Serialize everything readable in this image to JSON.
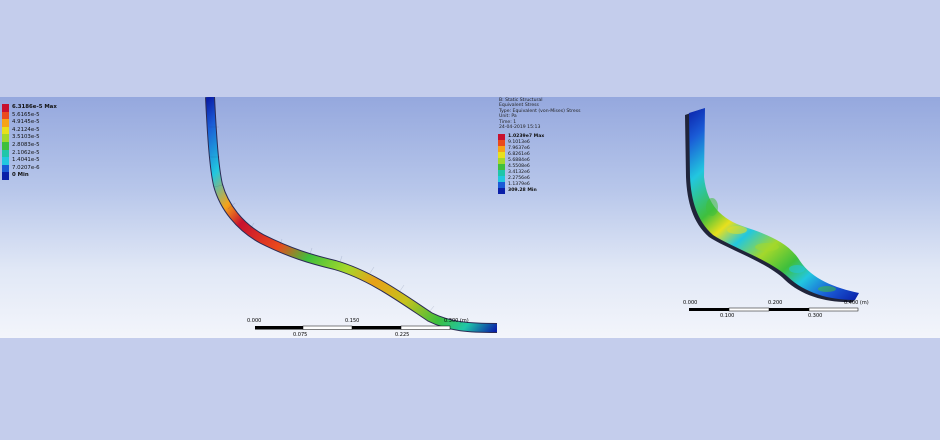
{
  "left_view": {
    "legend": [
      {
        "label": "6.3186e-5 Max",
        "color": "#c8102e",
        "kind": "max"
      },
      {
        "label": "5.6165e-5",
        "color": "#ea4a1c",
        "kind": "mid"
      },
      {
        "label": "4.9145e-5",
        "color": "#f6a318",
        "kind": "mid"
      },
      {
        "label": "4.2124e-5",
        "color": "#e8e01d",
        "kind": "mid"
      },
      {
        "label": "3.5103e-5",
        "color": "#a4d82b",
        "kind": "mid"
      },
      {
        "label": "2.8083e-5",
        "color": "#3fbf3c",
        "kind": "mid"
      },
      {
        "label": "2.1062e-5",
        "color": "#1fc6a9",
        "kind": "mid"
      },
      {
        "label": "1.4041e-5",
        "color": "#22c7df",
        "kind": "mid"
      },
      {
        "label": "7.0207e-6",
        "color": "#1a5bd6",
        "kind": "mid"
      },
      {
        "label": "0 Min",
        "color": "#0a1fa8",
        "kind": "min"
      }
    ],
    "scale": {
      "top_labels": [
        "0.000",
        "0.150",
        "0.300 (m)"
      ],
      "bottom_labels": [
        "0.075",
        "0.225"
      ]
    }
  },
  "right_view": {
    "info_lines": [
      "B: Static Structural",
      "Equivalent Stress",
      "Type: Equivalent (von-Mises) Stress",
      "Unit: Pa",
      "Time: 1",
      "24-04-2019 15:13"
    ],
    "legend": [
      {
        "label": "1.0239e7 Max",
        "color": "#c8102e",
        "kind": "max"
      },
      {
        "label": "9.1013e6",
        "color": "#ea4a1c",
        "kind": "mid"
      },
      {
        "label": "7.9637e6",
        "color": "#f6a318",
        "kind": "mid"
      },
      {
        "label": "6.8261e6",
        "color": "#e8e01d",
        "kind": "mid"
      },
      {
        "label": "5.6884e6",
        "color": "#a4d82b",
        "kind": "mid"
      },
      {
        "label": "4.5508e6",
        "color": "#3fbf3c",
        "kind": "mid"
      },
      {
        "label": "3.4132e6",
        "color": "#1fc6a9",
        "kind": "mid"
      },
      {
        "label": "2.2756e6",
        "color": "#22c7df",
        "kind": "mid"
      },
      {
        "label": "1.1379e6",
        "color": "#1a5bd6",
        "kind": "mid"
      },
      {
        "label": "309.28 Min",
        "color": "#0a1fa8",
        "kind": "min"
      }
    ],
    "scale": {
      "top_labels": [
        "0.000",
        "0.200",
        "0.400 (m)"
      ],
      "bottom_labels": [
        "0.100",
        "0.300"
      ]
    }
  }
}
